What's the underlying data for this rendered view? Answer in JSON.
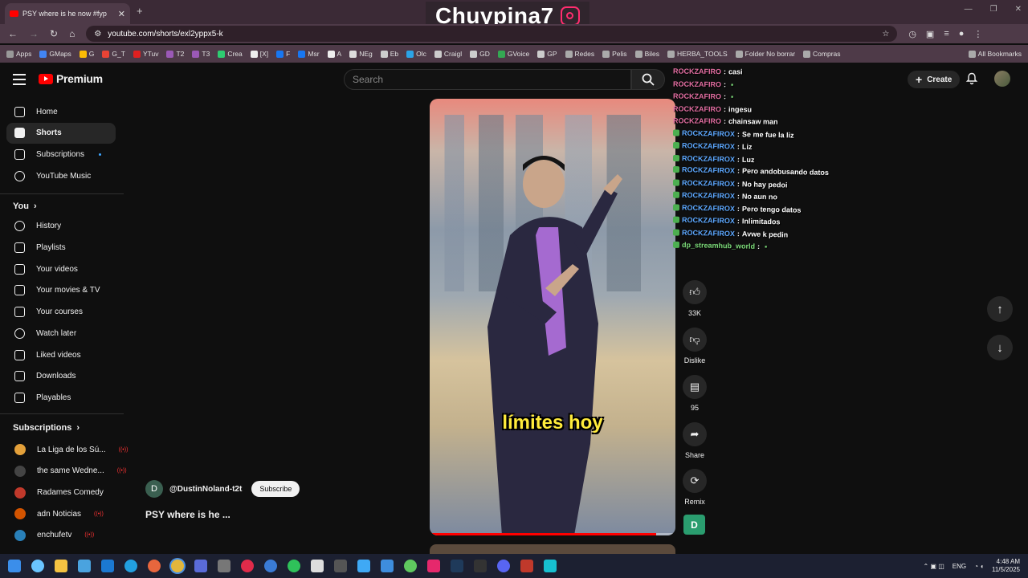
{
  "browser": {
    "tab_title": "PSY where is he now #fyp",
    "url": "youtube.com/shorts/exl2yppx5-k",
    "bookmarks": [
      "Apps",
      "GMaps",
      "G",
      "G_T",
      "YTuv",
      "T2",
      "T3",
      "Crea",
      "[X]",
      "F",
      "Msr",
      "A",
      "NEg",
      "Eb",
      "Olc",
      "Craigl",
      "GD",
      "GVoice",
      "GP",
      "Redes",
      "Pelis",
      "Biles",
      "HERBA_TOOLS",
      "Folder No borrar",
      "Compras"
    ],
    "all_bookmarks": "All Bookmarks"
  },
  "stream_overlay": {
    "brand": "Chuypina7",
    "brand_icon": "instagram-icon"
  },
  "youtube": {
    "logo_text": "Premium",
    "search_placeholder": "Search",
    "create_label": "Create",
    "sidebar": {
      "main": [
        "Home",
        "Shorts",
        "Subscriptions",
        "YouTube Music"
      ],
      "you_header": "You",
      "you_items": [
        "History",
        "Playlists",
        "Your videos",
        "Your movies & TV",
        "Your courses",
        "Watch later",
        "Liked videos",
        "Downloads",
        "Playables"
      ],
      "subs_header": "Subscriptions",
      "subscriptions": [
        "La Liga de los Sú...",
        "the same Wedne...",
        "Radames Comedy",
        "adn Noticias",
        "enchufetv"
      ]
    },
    "short": {
      "caption": "límites hoy",
      "channel_initial": "D",
      "channel": "@DustinNoland-t2t",
      "subscribe": "Subscribe",
      "title": "PSY where is he ...",
      "progress": 0.92
    },
    "actions": {
      "likes": "33K",
      "dislike": "Dislike",
      "comments": "95",
      "share": "Share",
      "remix": "Remix",
      "channel_initial": "D"
    }
  },
  "chat": [
    {
      "user": "ROCKZAFIRO",
      "color": "pink",
      "msg": "casi"
    },
    {
      "user": "ROCKZAFIRO",
      "color": "pink",
      "msg": ""
    },
    {
      "user": "ROCKZAFIRO",
      "color": "pink",
      "msg": ""
    },
    {
      "user": "ROCKZAFIRO",
      "color": "pink",
      "msg": "ingesu"
    },
    {
      "user": "ROCKZAFIRO",
      "color": "pink",
      "msg": "chainsaw man"
    },
    {
      "user": "ROCKZAFIROX",
      "color": "blue",
      "msg": "Se me fue la liz"
    },
    {
      "user": "ROCKZAFIROX",
      "color": "blue",
      "msg": "Liz"
    },
    {
      "user": "ROCKZAFIROX",
      "color": "blue",
      "msg": "Luz"
    },
    {
      "user": "ROCKZAFIROX",
      "color": "blue",
      "msg": "Pero andobusando datos"
    },
    {
      "user": "ROCKZAFIROX",
      "color": "blue",
      "msg": "No hay pedoi"
    },
    {
      "user": "ROCKZAFIROX",
      "color": "blue",
      "msg": "No aun no"
    },
    {
      "user": "ROCKZAFIROX",
      "color": "blue",
      "msg": "Pero tengo datos"
    },
    {
      "user": "ROCKZAFIROX",
      "color": "blue",
      "msg": "Inlimitados"
    },
    {
      "user": "ROCKZAFIROX",
      "color": "blue",
      "msg": "Avwe k pedin"
    },
    {
      "user": "dp_streamhub_world",
      "color": "green",
      "msg": ""
    }
  ],
  "taskbar": {
    "lang": "ENG",
    "time": "4:48 AM",
    "date": "11/5/2025"
  }
}
